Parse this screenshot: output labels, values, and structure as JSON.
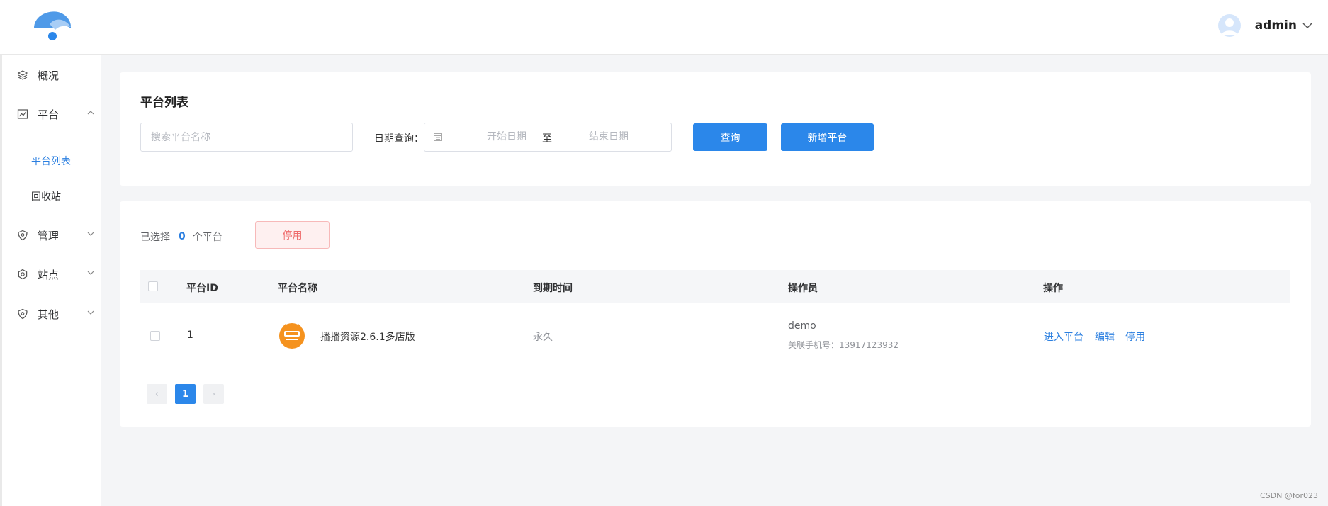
{
  "header": {
    "user_name": "admin"
  },
  "sidebar": {
    "items": [
      {
        "label": "概况",
        "icon": "layers-icon"
      },
      {
        "label": "平台",
        "icon": "line-chart-icon",
        "expanded": true
      },
      {
        "label": "管理",
        "icon": "shield-icon"
      },
      {
        "label": "站点",
        "icon": "gear-icon"
      },
      {
        "label": "其他",
        "icon": "shield-icon"
      }
    ],
    "sub_items": [
      {
        "label": "平台列表",
        "active": true
      },
      {
        "label": "回收站"
      }
    ]
  },
  "filter": {
    "title": "平台列表",
    "search_placeholder": "搜索平台名称",
    "date_label": "日期查询：",
    "start_placeholder": "开始日期",
    "range_separator": "至",
    "end_placeholder": "结束日期",
    "query_label": "查询",
    "add_label": "新增平台"
  },
  "selection": {
    "prefix": "已选择",
    "count": "0",
    "suffix": "个平台",
    "disable_label": "停用"
  },
  "table": {
    "columns": [
      "平台ID",
      "平台名称",
      "到期时间",
      "操作员",
      "操作"
    ],
    "rows": [
      {
        "id": "1",
        "name": "播播资源2.6.1多店版",
        "expiry": "永久",
        "operator": "demo",
        "operator_phone": "关联手机号：13917123932",
        "actions": [
          "进入平台",
          "编辑",
          "停用"
        ]
      }
    ]
  },
  "pagination": {
    "current": "1",
    "prev": "‹",
    "next": "›"
  },
  "colors": {
    "primary": "#2b87ea",
    "danger": "#ef6c6c",
    "logo_orange": "#f5921e"
  },
  "watermark": "CSDN @for023"
}
